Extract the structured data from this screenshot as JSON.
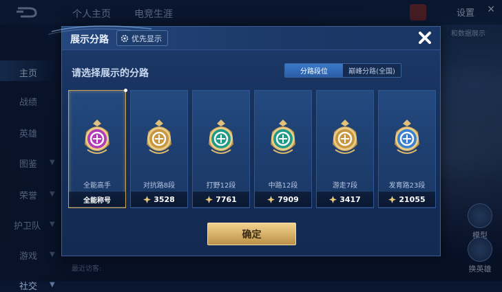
{
  "background": {
    "top_tabs": [
      "个人主页",
      "电竞生涯"
    ],
    "settings_label": "设置",
    "sidebar": [
      {
        "label": "主页",
        "active": true
      },
      {
        "label": "战绩"
      },
      {
        "label": "英雄"
      },
      {
        "label": "图鉴"
      },
      {
        "label": "荣誉"
      },
      {
        "label": "护卫队"
      },
      {
        "label": "游戏"
      },
      {
        "label": "社交"
      }
    ],
    "right_buttons": [
      "模型",
      "换英雄"
    ],
    "recent_label": "最近访客:",
    "banner_text": "和数据展示"
  },
  "modal": {
    "title": "展示分路",
    "priority_label": "优先显示",
    "subtitle": "请选择展示的分路",
    "tabs": [
      {
        "label": "分路段位",
        "active": true
      },
      {
        "label": "巅峰分路(全国)",
        "active": false
      }
    ],
    "cards": [
      {
        "name": "全能高手",
        "stat": "全能称号",
        "stat_is_number": false,
        "selected": true,
        "badge": "all-round-badge-icon",
        "badge_color": "#b13bb8"
      },
      {
        "name": "对抗路8段",
        "stat": "3528",
        "stat_is_number": true,
        "selected": false,
        "badge": "clash-lane-badge-icon",
        "badge_color": "#c8963e"
      },
      {
        "name": "打野12段",
        "stat": "7761",
        "stat_is_number": true,
        "selected": false,
        "badge": "jungle-badge-icon",
        "badge_color": "#1f9a86"
      },
      {
        "name": "中路12段",
        "stat": "7909",
        "stat_is_number": true,
        "selected": false,
        "badge": "mid-lane-badge-icon",
        "badge_color": "#1f9a86"
      },
      {
        "name": "游走7段",
        "stat": "3417",
        "stat_is_number": true,
        "selected": false,
        "badge": "roam-badge-icon",
        "badge_color": "#c8963e"
      },
      {
        "name": "发育路23段",
        "stat": "21055",
        "stat_is_number": true,
        "selected": false,
        "badge": "farm-lane-badge-icon",
        "badge_color": "#3b7fd0"
      }
    ],
    "confirm_label": "确定"
  },
  "colors": {
    "accent_gold": "#d5ae66",
    "tab_active": "#3b79c9",
    "panel": "#1d3a6a"
  }
}
